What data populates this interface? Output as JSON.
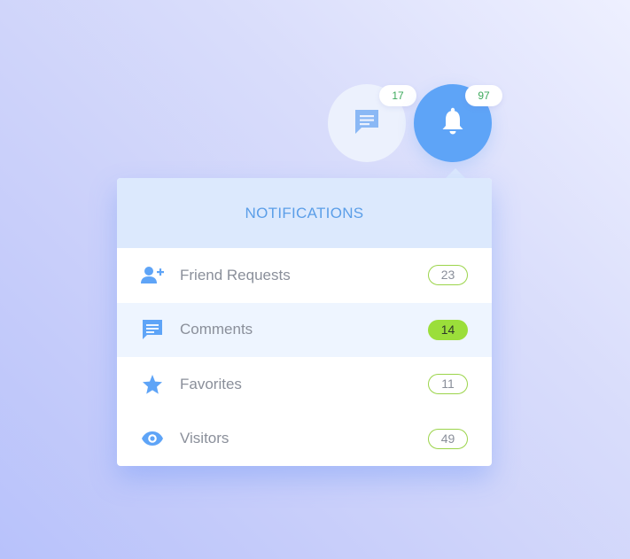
{
  "top_buttons": {
    "messages": {
      "icon": "chat-message-icon",
      "count": "17"
    },
    "notifications": {
      "icon": "bell-icon",
      "count": "97"
    }
  },
  "panel": {
    "title": "NOTIFICATIONS",
    "items": [
      {
        "label": "Friend Requests",
        "count": "23",
        "icon": "add-user-icon",
        "badge_style": "outline"
      },
      {
        "label": "Comments",
        "count": "14",
        "icon": "comment-icon",
        "badge_style": "filled",
        "highlighted": true
      },
      {
        "label": "Favorites",
        "count": "11",
        "icon": "star-icon",
        "badge_style": "outline"
      },
      {
        "label": "Visitors",
        "count": "49",
        "icon": "eye-icon",
        "badge_style": "outline"
      }
    ]
  },
  "colors": {
    "accent_blue": "#5ea4f7",
    "header_bg": "#dce9fd",
    "badge_green": "#9bde3a",
    "count_text_green": "#3daa5c"
  }
}
